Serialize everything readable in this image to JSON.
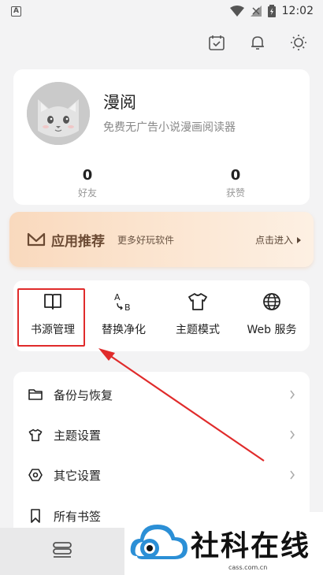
{
  "status_bar": {
    "notification_letter": "A",
    "time": "12:02"
  },
  "top_icons": [
    "calendar-icon",
    "bell-icon",
    "sun-icon"
  ],
  "profile": {
    "name": "漫阅",
    "description": "免费无广告小说漫画阅读器",
    "friends_count": "0",
    "friends_label": "好友",
    "likes_count": "0",
    "likes_label": "获赞"
  },
  "promo": {
    "title": "应用推荐",
    "subtitle": "更多好玩软件",
    "enter_label": "点击进入"
  },
  "actions": [
    {
      "label": "书源管理",
      "icon": "book-open-icon"
    },
    {
      "label": "替换净化",
      "icon": "replace-ab-icon"
    },
    {
      "label": "主题模式",
      "icon": "tshirt-icon"
    },
    {
      "label": "Web 服务",
      "icon": "globe-icon"
    }
  ],
  "menu": [
    {
      "label": "备份与恢复",
      "icon": "folder-icon"
    },
    {
      "label": "主题设置",
      "icon": "tshirt-icon"
    },
    {
      "label": "其它设置",
      "icon": "settings-icon"
    },
    {
      "label": "所有书签",
      "icon": "bookmark-icon"
    }
  ],
  "watermark": {
    "text": "社科在线",
    "url": "cass.com.cn"
  },
  "colors": {
    "accent_red": "#e02b2b",
    "promo_brown": "#6b4a33",
    "watermark_blue": "#2b8fd6"
  }
}
